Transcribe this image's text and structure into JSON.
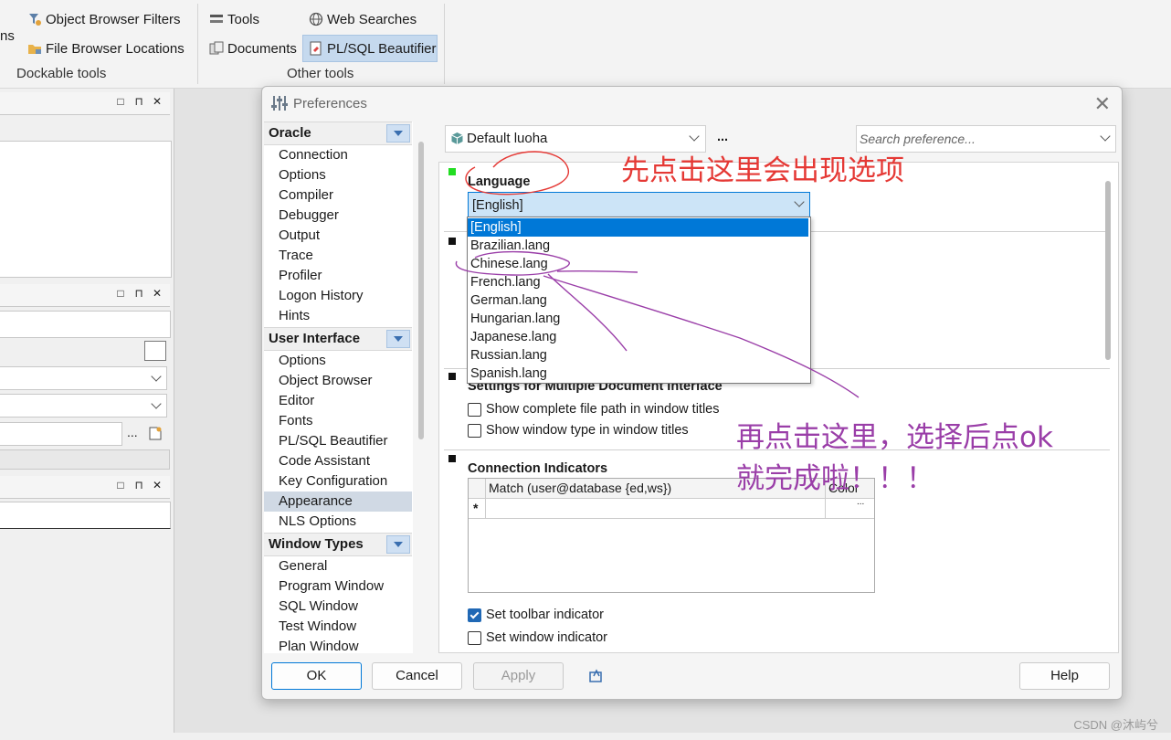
{
  "ribbon": {
    "cut_label": "ns",
    "object_browser_filters": "Object Browser Filters",
    "file_browser_locations": "File Browser Locations",
    "dockable_group": "Dockable tools",
    "tools": "Tools",
    "web_searches": "Web Searches",
    "documents": "Documents",
    "plsql_beautifier": "PL/SQL Beautifier",
    "other_group": "Other tools"
  },
  "left_panes": {
    "button_glyphs": {
      "restore": "□",
      "pin": "⊓",
      "close": "✕"
    },
    "ellipsis": "..."
  },
  "dialog": {
    "title": "Preferences",
    "close_glyph": "✕",
    "profile": "Default luoha",
    "profile_more": "...",
    "search_placeholder": "Search preference...",
    "nav": {
      "oracle": {
        "label": "Oracle",
        "items": [
          "Connection",
          "Options",
          "Compiler",
          "Debugger",
          "Output",
          "Trace",
          "Profiler",
          "Logon History",
          "Hints"
        ]
      },
      "user_interface": {
        "label": "User Interface",
        "items": [
          "Options",
          "Object Browser",
          "Editor",
          "Fonts",
          "PL/SQL Beautifier",
          "Code Assistant",
          "Key Configuration",
          "Appearance",
          "NLS Options"
        ]
      },
      "window_types": {
        "label": "Window Types",
        "items": [
          "General",
          "Program Window",
          "SQL Window",
          "Test Window",
          "Plan Window"
        ]
      }
    },
    "selected_nav": "Appearance",
    "language": {
      "title": "Language",
      "value": "[English]",
      "options": [
        "[English]",
        "Brazilian.lang",
        "Chinese.lang",
        "French.lang",
        "German.lang",
        "Hungarian.lang",
        "Japanese.lang",
        "Russian.lang",
        "Spanish.lang"
      ]
    },
    "mdi": {
      "title": "Settings for Multiple Document Interface",
      "show_path": "Show complete file path in window titles",
      "show_type": "Show window type in window titles"
    },
    "conn": {
      "title": "Connection Indicators",
      "col_match": "Match (user@database {ed,ws})",
      "col_color": "Color",
      "new_row_marker": "*",
      "cell_more": "...",
      "set_toolbar": "Set toolbar indicator",
      "set_window": "Set window indicator",
      "set_toolbar_checked": true,
      "set_window_checked": false
    },
    "buttons": {
      "ok": "OK",
      "cancel": "Cancel",
      "apply": "Apply",
      "help": "Help"
    }
  },
  "annotations": {
    "red": "先点击这里会出现选项",
    "purple_line1": "再点击这里，选择后点ok",
    "purple_line2": "就完成啦！！！"
  },
  "watermark": "CSDN @沐屿兮",
  "colors": {
    "accent": "#0078d7",
    "annotation_red": "#e53935",
    "annotation_purple": "#9a3ea8"
  }
}
